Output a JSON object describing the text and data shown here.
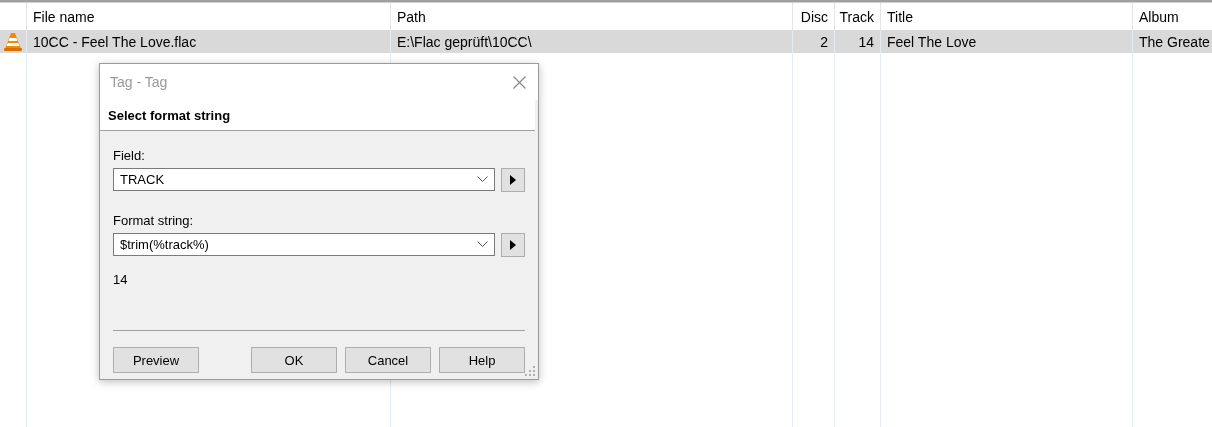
{
  "table": {
    "columns": [
      {
        "label": "File name",
        "kind": "text"
      },
      {
        "label": "Path",
        "kind": "text"
      },
      {
        "label": "Disc",
        "kind": "number"
      },
      {
        "label": "Track",
        "kind": "number"
      },
      {
        "label": "Title",
        "kind": "text"
      },
      {
        "label": "Album",
        "kind": "text"
      }
    ],
    "rows": [
      {
        "selected": true,
        "cells": [
          "10CC - Feel The Love.flac",
          "E:\\Flac geprüft\\10CC\\",
          "2",
          "14",
          "Feel The Love",
          "The Greate"
        ]
      }
    ]
  },
  "dialog": {
    "title": "Tag - Tag",
    "heading": "Select format string",
    "fields": [
      {
        "label": "Field:",
        "value": "TRACK"
      },
      {
        "label": "Format string:",
        "value": "$trim(%track%)"
      }
    ],
    "result": "14",
    "buttons": [
      {
        "label": "Preview",
        "kind": "left"
      },
      {
        "label": "OK",
        "kind": "right"
      },
      {
        "label": "Cancel",
        "kind": "right"
      },
      {
        "label": "Help",
        "kind": "right"
      }
    ]
  }
}
